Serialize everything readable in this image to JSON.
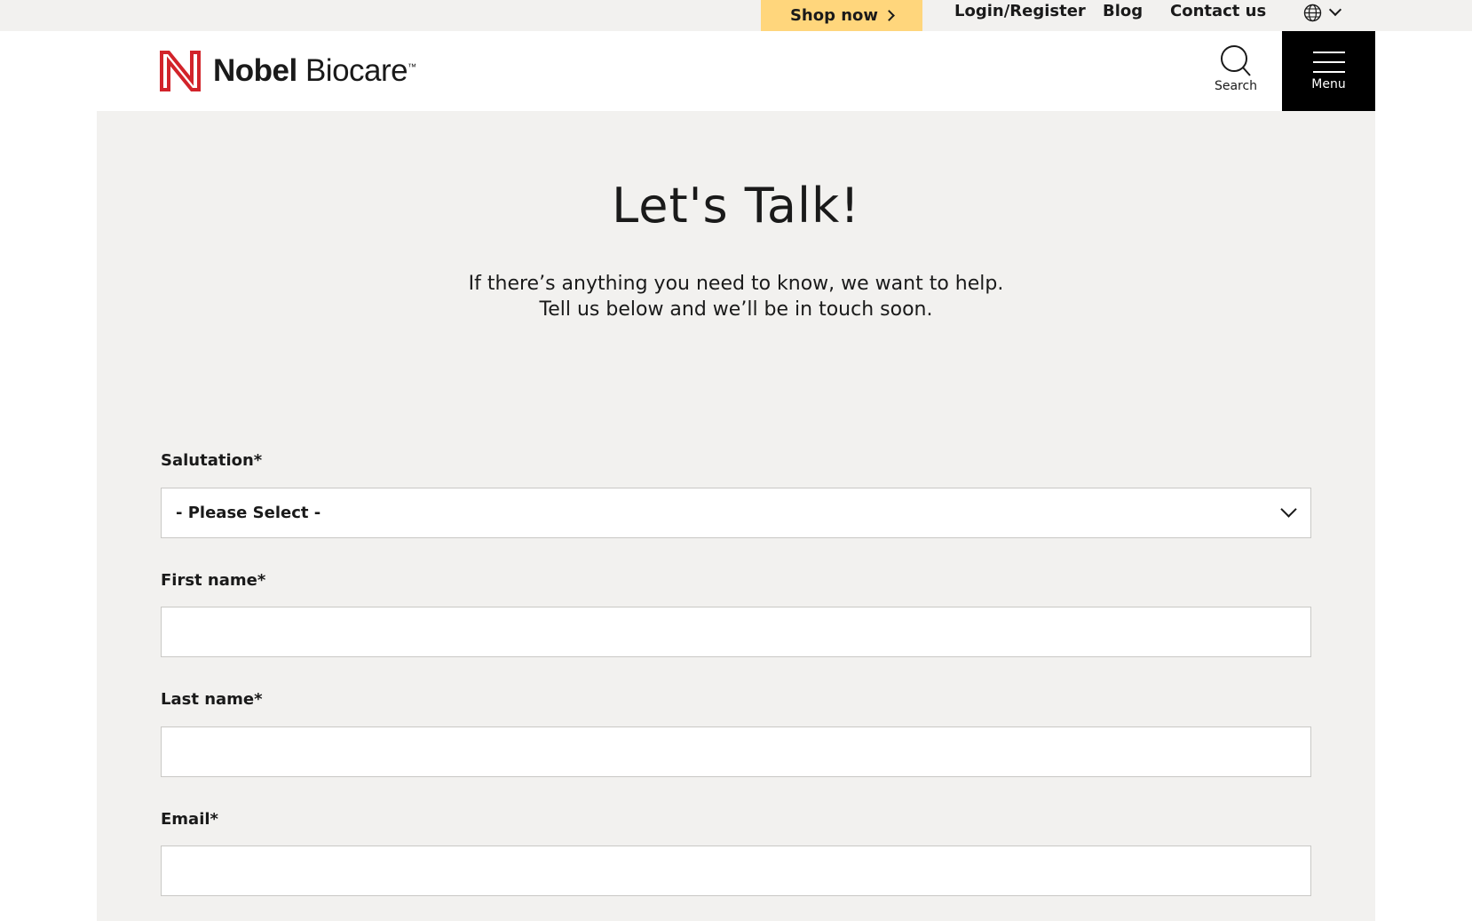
{
  "utility": {
    "shop_now": "Shop now",
    "login": "Login/Register",
    "blog": "Blog",
    "contact": "Contact us"
  },
  "header": {
    "logo_bold": "Nobel",
    "logo_light": " Biocare",
    "logo_tm": "™",
    "search_label": "Search",
    "menu_label": "Menu"
  },
  "main": {
    "title": "Let's Talk!",
    "intro_line1": "If there’s anything you need to know, we want to help.",
    "intro_line2": "Tell us below and we’ll be in touch soon."
  },
  "form": {
    "salutation_label": "Salutation*",
    "salutation_value": "- Please Select -",
    "first_name_label": "First name*",
    "first_name_value": "",
    "last_name_label": "Last name*",
    "last_name_value": "",
    "email_label": "Email*",
    "email_value": ""
  },
  "colors": {
    "shop_now_bg": "#ffd67c",
    "logo_red": "#d2232a",
    "panel_bg": "#f2f1ef",
    "menu_bg": "#000000"
  },
  "icons": {
    "shop_chevron": "chevron-right-icon",
    "language": "globe-icon",
    "language_toggle": "chevron-down-icon",
    "logo_mark": "nobel-n-logo-icon",
    "search": "search-icon",
    "menu": "hamburger-menu-icon",
    "select_toggle": "chevron-down-icon"
  }
}
